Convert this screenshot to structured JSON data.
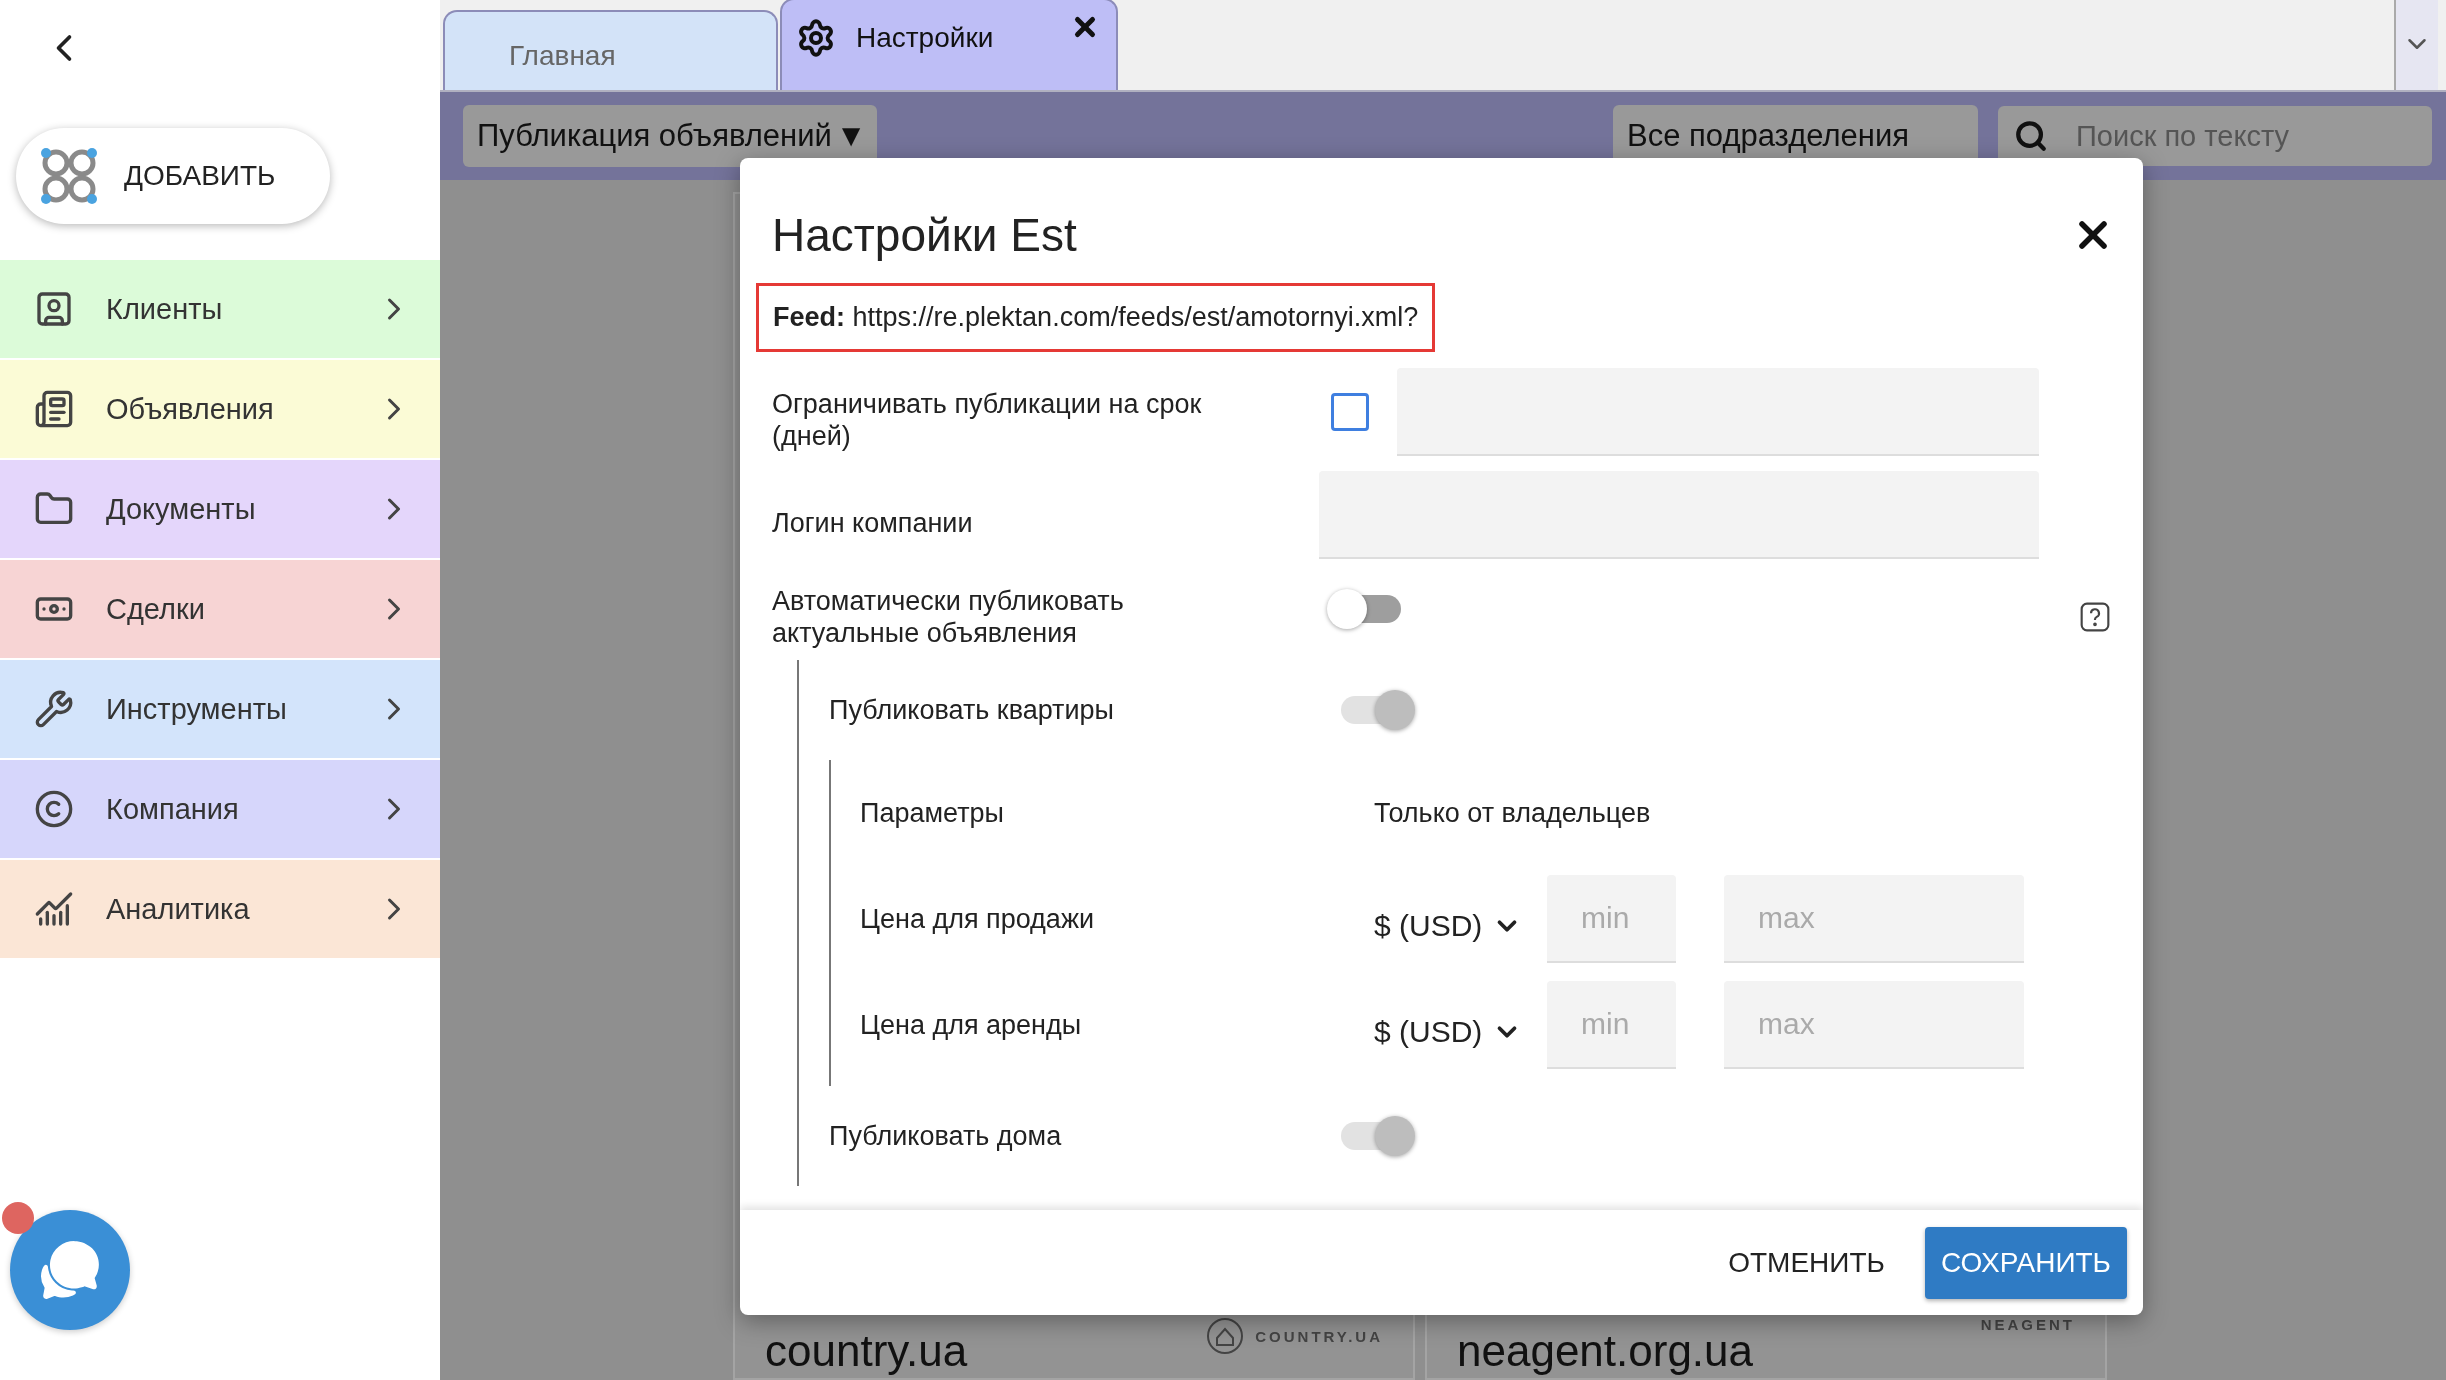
{
  "sidebar": {
    "add_button": "ДОБАВИТЬ",
    "items": [
      {
        "kind": "clients",
        "label": "Клиенты",
        "color": "#dcfbd9"
      },
      {
        "kind": "ads",
        "label": "Объявления",
        "color": "#fbfbd6"
      },
      {
        "kind": "documents",
        "label": "Документы",
        "color": "#e4d6fb"
      },
      {
        "kind": "deals",
        "label": "Сделки",
        "color": "#f7d4d4"
      },
      {
        "kind": "tools",
        "label": "Инструменты",
        "color": "#d3e4fb"
      },
      {
        "kind": "company",
        "label": "Компания",
        "color": "#d6d6fb"
      },
      {
        "kind": "analytics",
        "label": "Аналитика",
        "color": "#fbe6d6"
      }
    ]
  },
  "tabs": [
    {
      "label": "Главная",
      "selected": false,
      "closable": false
    },
    {
      "label": "Настройки",
      "selected": true,
      "closable": true
    }
  ],
  "toolbar": {
    "section_select": "Публикация объявлений",
    "section_caret": "▼",
    "department_select": "Все подразделения",
    "search": {
      "placeholder": "Поиск по тексту"
    }
  },
  "cards": [
    {
      "title": "country.ua",
      "logo": "COUNTRY.UA"
    },
    {
      "title": "neagent.org.ua",
      "logo": "NEAGENT"
    }
  ],
  "dialog": {
    "title": "Настройки Est",
    "feed": "**Feed:** https://re.plektan.com/feeds/est/amotornyi.xml?",
    "fields": [
      {
        "kind": "checkbox_input",
        "label": "Ограничивать публикации на срок (дней)",
        "checked": false
      },
      {
        "kind": "input",
        "label": "Логин компании"
      },
      {
        "kind": "toggle",
        "label": "Автоматически публиковать актуальные объявления",
        "on": false,
        "disabled": false,
        "help": true
      }
    ],
    "sections": [
      {
        "label": "Публиковать квартиры",
        "on": true,
        "disabled": true,
        "params": {
          "label": "Параметры",
          "value": "Только от владельцев",
          "prices": [
            {
              "label": "Цена для продажи",
              "currency": "$ (USD)",
              "min_placeholder": "min",
              "max_placeholder": "max"
            },
            {
              "label": "Цена для аренды",
              "currency": "$ (USD)",
              "min_placeholder": "min",
              "max_placeholder": "max"
            }
          ]
        }
      },
      {
        "label": "Публиковать дома",
        "on": true,
        "disabled": true
      }
    ],
    "cancel": "ОТМЕНИТЬ",
    "save": "СОХРАНИТЬ"
  },
  "chat": {
    "unread": true
  }
}
